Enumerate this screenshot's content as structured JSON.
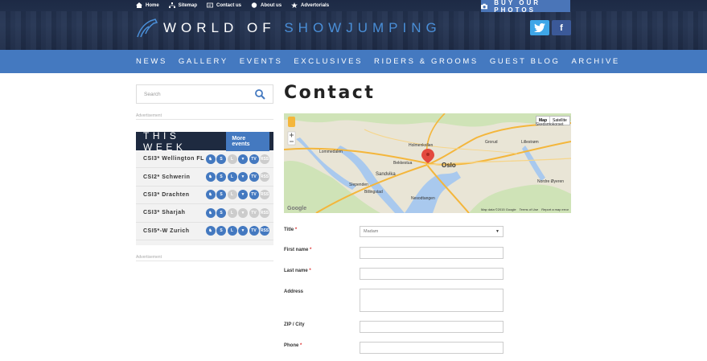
{
  "top_links": [
    {
      "label": "Home",
      "icon": "home-icon"
    },
    {
      "label": "Sitemap",
      "icon": "sitemap-icon"
    },
    {
      "label": "Contact us",
      "icon": "contact-icon"
    },
    {
      "label": "About us",
      "icon": "about-icon"
    },
    {
      "label": "Advertorials",
      "icon": "star-icon"
    }
  ],
  "buy_photos": "BUY OUR PHOTOS",
  "logo": {
    "part1": "WORLD OF",
    "part2": "SHOWJUMPING"
  },
  "social": {
    "twitter": "twitter-icon",
    "facebook": "f"
  },
  "nav": [
    "NEWS",
    "GALLERY",
    "EVENTS",
    "EXCLUSIVES",
    "RIDERS & GROOMS",
    "GUEST BLOG",
    "ARCHIVE"
  ],
  "search": {
    "placeholder": "Search"
  },
  "advertisement": "Advertisement",
  "this_week": {
    "title": "THIS WEEK",
    "more_label": "More events"
  },
  "events": [
    {
      "name": "CSI3* Wellington FL",
      "icons": [
        {
          "t": "♞",
          "on": true
        },
        {
          "t": "S",
          "on": true
        },
        {
          "t": "L",
          "on": false
        },
        {
          "t": "▼",
          "on": true
        },
        {
          "t": "TV",
          "on": true
        },
        {
          "t": "RSS",
          "on": false
        }
      ]
    },
    {
      "name": "CSI2* Schwerin",
      "icons": [
        {
          "t": "♞",
          "on": true
        },
        {
          "t": "S",
          "on": true
        },
        {
          "t": "L",
          "on": true
        },
        {
          "t": "▼",
          "on": true
        },
        {
          "t": "TV",
          "on": true
        },
        {
          "t": "RSS",
          "on": false
        }
      ]
    },
    {
      "name": "CSI3* Drachten",
      "icons": [
        {
          "t": "♞",
          "on": true
        },
        {
          "t": "S",
          "on": true
        },
        {
          "t": "L",
          "on": false
        },
        {
          "t": "▼",
          "on": true
        },
        {
          "t": "TV",
          "on": true
        },
        {
          "t": "RSS",
          "on": false
        }
      ]
    },
    {
      "name": "CSI3* Sharjah",
      "icons": [
        {
          "t": "♞",
          "on": true
        },
        {
          "t": "S",
          "on": true
        },
        {
          "t": "L",
          "on": false
        },
        {
          "t": "▼",
          "on": false
        },
        {
          "t": "TV",
          "on": false
        },
        {
          "t": "RSS",
          "on": false
        }
      ]
    },
    {
      "name": "CSI5*-W Zurich",
      "icons": [
        {
          "t": "♞",
          "on": true
        },
        {
          "t": "S",
          "on": true
        },
        {
          "t": "L",
          "on": true
        },
        {
          "t": "▼",
          "on": true
        },
        {
          "t": "TV",
          "on": true
        },
        {
          "t": "RSS",
          "on": true
        }
      ]
    }
  ],
  "page_title": "Contact",
  "map": {
    "type_map": "Map",
    "type_satellite": "Satellite",
    "google": "Google",
    "data": "Map data ©2015 Google",
    "terms": "Terms of Use",
    "report": "Report a map error",
    "places": [
      "Lommedalen",
      "Holmenkollen",
      "Grorud",
      "Lillestrøm",
      "Oslo",
      "Bekkestua",
      "Sandvika",
      "Slependen",
      "Billingstad",
      "Nesodtangen",
      "Nordre Øyeren",
      "Skedsmokorset"
    ]
  },
  "form": {
    "title_label": "Title",
    "title_value": "Madam",
    "first_name_label": "First name",
    "last_name_label": "Last name",
    "address_label": "Address",
    "zip_label": "ZIP / City",
    "phone_label": "Phone",
    "required": "*"
  },
  "colors": {
    "accent": "#4479c0",
    "header_dark": "#1e2a40",
    "twitter": "#3ea6e8",
    "facebook": "#3b5998"
  }
}
